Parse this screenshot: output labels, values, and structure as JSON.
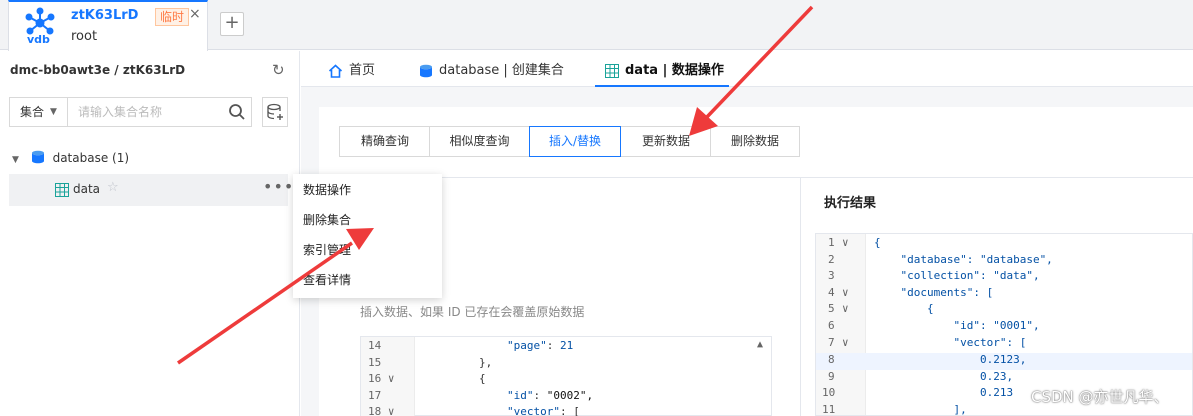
{
  "connection_tab": {
    "logo_text": "vdb",
    "name": "ztK63LrD",
    "badge": "临时",
    "close": "×",
    "user": "root",
    "add": "+"
  },
  "sidebar": {
    "path": "dmc-bb0awt3e / ztK63LrD",
    "refresh": "↻",
    "search_select": "集合",
    "search_placeholder": "请输入集合名称",
    "tree": {
      "database": "database (1)",
      "collection": "data",
      "star": "☆",
      "more": "•••"
    }
  },
  "context_menu": {
    "items": [
      "数据操作",
      "删除集合",
      "索引管理",
      "查看详情"
    ]
  },
  "main_tabs": [
    "首页",
    "database | 创建集合",
    "data | 数据操作"
  ],
  "op_tabs": [
    "精确查询",
    "相似度查询",
    "插入/替换",
    "更新数据",
    "删除数据"
  ],
  "hint": "插入数据、如果 ID 已存在会覆盖原始数据",
  "editor": {
    "lines": [
      {
        "n": "14",
        "fold": "",
        "code": [
          "\"page\"",
          ": ",
          "21"
        ]
      },
      {
        "n": "15",
        "fold": "",
        "code": [
          "},"
        ]
      },
      {
        "n": "16",
        "fold": "∨",
        "code": [
          "{"
        ]
      },
      {
        "n": "17",
        "fold": "",
        "code": [
          "\"id\"",
          ": ",
          "\"0002\","
        ]
      },
      {
        "n": "18",
        "fold": "∨",
        "code": [
          "\"vector\"",
          ": ["
        ]
      }
    ]
  },
  "result": {
    "title": "执行结果",
    "lines": [
      {
        "n": "1",
        "fold": "∨",
        "code": "{"
      },
      {
        "n": "2",
        "fold": "",
        "code": "    \"database\": \"database\","
      },
      {
        "n": "3",
        "fold": "",
        "code": "    \"collection\": \"data\","
      },
      {
        "n": "4",
        "fold": "∨",
        "code": "    \"documents\": ["
      },
      {
        "n": "5",
        "fold": "∨",
        "code": "        {"
      },
      {
        "n": "6",
        "fold": "",
        "code": "            \"id\": \"0001\","
      },
      {
        "n": "7",
        "fold": "∨",
        "code": "            \"vector\": ["
      },
      {
        "n": "8",
        "fold": "",
        "code": "                0.2123,"
      },
      {
        "n": "9",
        "fold": "",
        "code": "                0.23,"
      },
      {
        "n": "10",
        "fold": "",
        "code": "                0.213"
      },
      {
        "n": "11",
        "fold": "",
        "code": "            ],"
      }
    ]
  },
  "watermark": "CSDN @亦世凡华、",
  "colors": {
    "accent": "#1677ff",
    "arrow": "#ee3b3b",
    "badge": "#ff7a45"
  }
}
